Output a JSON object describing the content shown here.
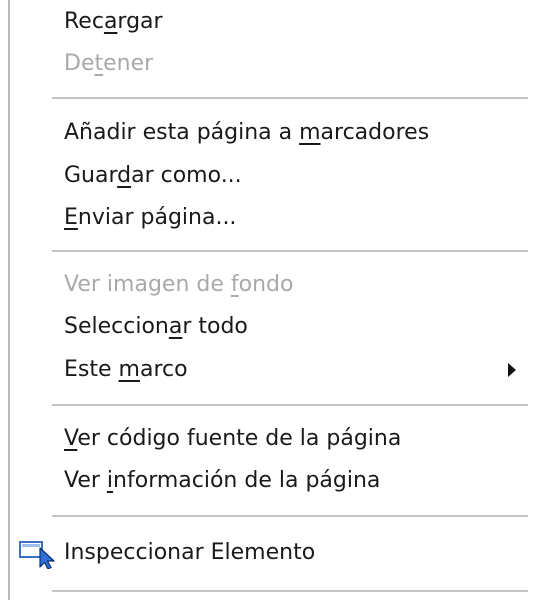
{
  "menu": {
    "items": [
      {
        "id": "reload",
        "pre": "Rec",
        "acc": "a",
        "post": "rgar",
        "enabled": true
      },
      {
        "id": "stop",
        "pre": "De",
        "acc": "t",
        "post": "ener",
        "enabled": false
      },
      {
        "id": "bookmark",
        "pre": "Añadir esta página a ",
        "acc": "m",
        "post": "arcadores",
        "enabled": true
      },
      {
        "id": "save-as",
        "pre": "Guar",
        "acc": "d",
        "post": "ar como...",
        "enabled": true
      },
      {
        "id": "send-page",
        "pre": "",
        "acc": "E",
        "post": "nviar página...",
        "enabled": true
      },
      {
        "id": "view-background",
        "pre": "Ver imagen de ",
        "acc": "f",
        "post": "ondo",
        "enabled": false
      },
      {
        "id": "select-all",
        "pre": "Seleccion",
        "acc": "a",
        "post": "r todo",
        "enabled": true
      },
      {
        "id": "this-frame",
        "pre": "Este ",
        "acc": "m",
        "post": "arco",
        "enabled": true,
        "submenu": true
      },
      {
        "id": "view-source",
        "pre": "",
        "acc": "V",
        "post": "er código fuente de la página",
        "enabled": true
      },
      {
        "id": "page-info",
        "pre": "Ver ",
        "acc": "i",
        "post": "nformación de la página",
        "enabled": true
      },
      {
        "id": "inspect",
        "pre": "Inspeccionar Elemento",
        "acc": "",
        "post": "",
        "enabled": true,
        "icon": "inspect-element-icon"
      }
    ]
  },
  "colors": {
    "text": "#1a1a1a",
    "disabled_text": "#a9a9a9",
    "separator": "#c4c4c4",
    "border": "#b9b9b9",
    "icon_accent": "#2f6fd6"
  }
}
